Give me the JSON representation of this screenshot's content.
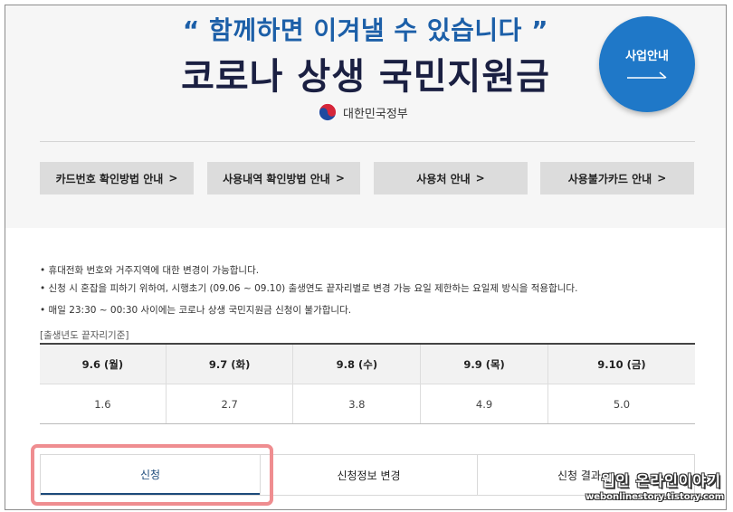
{
  "hero": {
    "slogan": "“ 함께하면 이겨낼 수 있습니다 ”",
    "title": "코로나 상생 국민지원금",
    "gov_label": "대한민국정부",
    "info_button": "사업안내"
  },
  "nav_buttons": [
    {
      "label": "카드번호 확인방법 안내"
    },
    {
      "label": "사용내역 확인방법 안내"
    },
    {
      "label": "사용처 안내"
    },
    {
      "label": "사용불가카드 안내"
    }
  ],
  "nav_arrow": ">",
  "notes": [
    "• 휴대전화 번호와 거주지역에 대한 변경이 가능합니다.",
    "• 신청 시 혼잡을 피하기 위하여, 시행초기 (09.06 ~ 09.10) 출생연도 끝자리별로 변경 가능 요일 제한하는 요일제 방식을 적용합니다.",
    "• 매일 23:30 ~ 00:30 사이에는 코로나 상생 국민지원금 신청이 불가합니다."
  ],
  "schedule": {
    "caption": "[출생년도 끝자리기준]",
    "headers": [
      "9.6 (월)",
      "9.7 (화)",
      "9.8 (수)",
      "9.9 (목)",
      "9.10 (금)"
    ],
    "values": [
      "1.6",
      "2.7",
      "3.8",
      "4.9",
      "5.0"
    ]
  },
  "tabs": [
    {
      "label": "신청",
      "active": true
    },
    {
      "label": "신청정보 변경",
      "active": false
    },
    {
      "label": "신청 결과",
      "active": false
    }
  ],
  "watermark": {
    "main": "웹인 온라인이야기",
    "sub": "webonlinestory.tistory.com"
  },
  "colors": {
    "accent_blue": "#1f78c8",
    "title_navy": "#1b2042",
    "highlight": "#ef8d90"
  }
}
